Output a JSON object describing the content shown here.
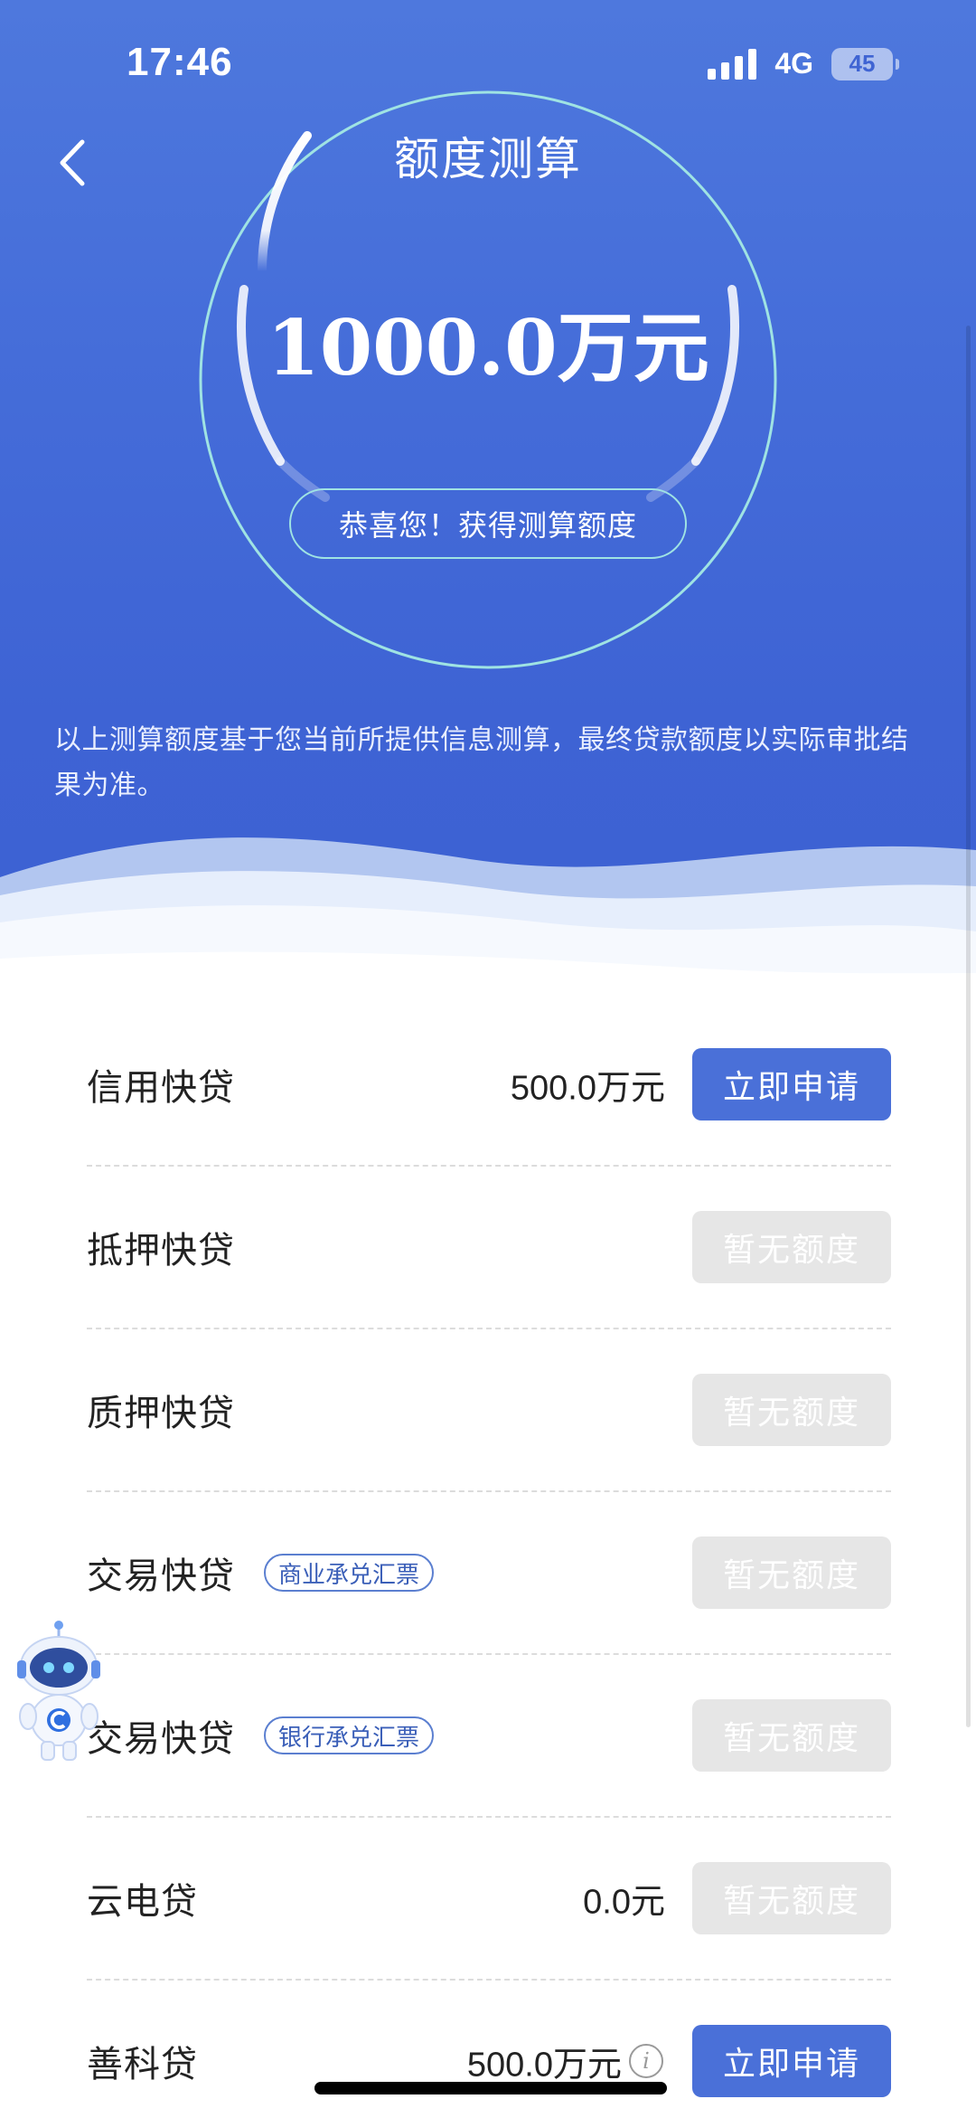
{
  "status": {
    "time": "17:46",
    "network": "4G",
    "battery": "45"
  },
  "nav": {
    "title": "额度测算"
  },
  "result": {
    "amount": "1000.0万元",
    "congrats": "恭喜您！获得测算额度",
    "disclaimer": "以上测算额度基于您当前所提供信息测算，最终贷款额度以实际审批结果为准。"
  },
  "loans": [
    {
      "name": "信用快贷",
      "tag": "",
      "amount": "500.0万元",
      "button": "立即申请",
      "button_state": "active"
    },
    {
      "name": "抵押快贷",
      "tag": "",
      "amount": "",
      "button": "暂无额度",
      "button_state": "disabled"
    },
    {
      "name": "质押快贷",
      "tag": "",
      "amount": "",
      "button": "暂无额度",
      "button_state": "disabled"
    },
    {
      "name": "交易快贷",
      "tag": "商业承兑汇票",
      "amount": "",
      "button": "暂无额度",
      "button_state": "disabled"
    },
    {
      "name": "交易快贷",
      "tag": "银行承兑汇票",
      "amount": "",
      "button": "暂无额度",
      "button_state": "disabled"
    },
    {
      "name": "云电贷",
      "tag": "",
      "amount": "0.0元",
      "button": "暂无额度",
      "button_state": "disabled"
    },
    {
      "name": "善科贷",
      "tag": "",
      "amount": "500.0万元",
      "button": "立即申请",
      "button_state": "active",
      "info": "i"
    }
  ],
  "colors": {
    "primary": "#4A70D8",
    "hero": "#4169D6",
    "disabled": "#E6E6E6",
    "ring": "#9FE3E3"
  },
  "icons": {
    "back": "chevron-left-icon",
    "info": "info-icon",
    "assistant": "robot-assistant-icon"
  }
}
